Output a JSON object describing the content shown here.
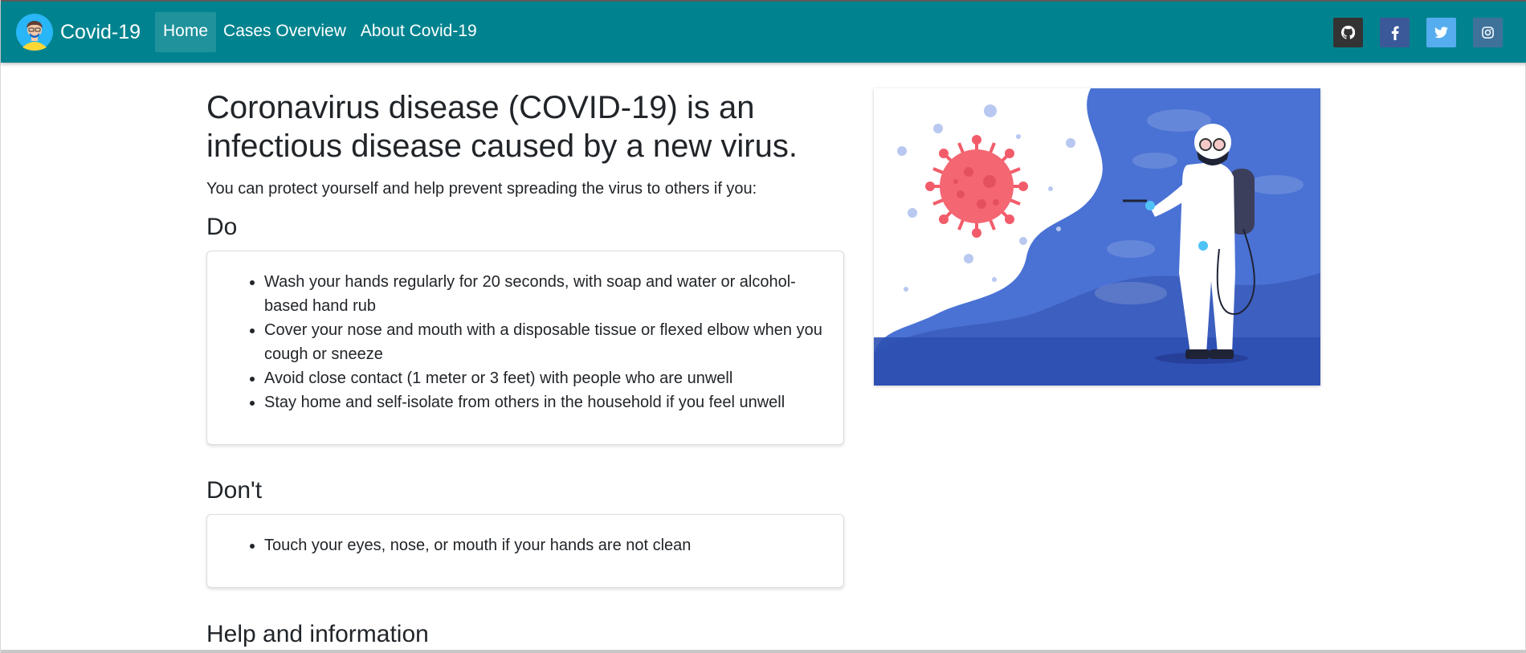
{
  "navbar": {
    "brand": "Covid-19",
    "links": [
      {
        "label": "Home",
        "active": true
      },
      {
        "label": "Cases Overview",
        "active": false
      },
      {
        "label": "About Covid-19",
        "active": false
      }
    ],
    "social": [
      {
        "icon": "github-icon",
        "color": "#333333"
      },
      {
        "icon": "facebook-icon",
        "color": "#3b5998"
      },
      {
        "icon": "twitter-icon",
        "color": "#55acee"
      },
      {
        "icon": "instagram-icon",
        "color": "#3f729b"
      }
    ],
    "color": "#00838f"
  },
  "main": {
    "headline": "Coronavirus disease (COVID-19) is an infectious disease caused by a new virus.",
    "intro": "You can protect yourself and help prevent spreading the virus to others if you:",
    "do": {
      "title": "Do",
      "items": [
        "Wash your hands regularly for 20 seconds, with soap and water or alcohol-based hand rub",
        "Cover your nose and mouth with a disposable tissue or flexed elbow when you cough or sneeze",
        "Avoid close contact (1 meter or 3 feet) with people who are unwell",
        "Stay home and self-isolate from others in the household if you feel unwell"
      ]
    },
    "dont": {
      "title": "Don't",
      "items": [
        "Touch your eyes, nose, or mouth if your hands are not clean"
      ]
    },
    "help": {
      "title": "Help and information"
    }
  }
}
